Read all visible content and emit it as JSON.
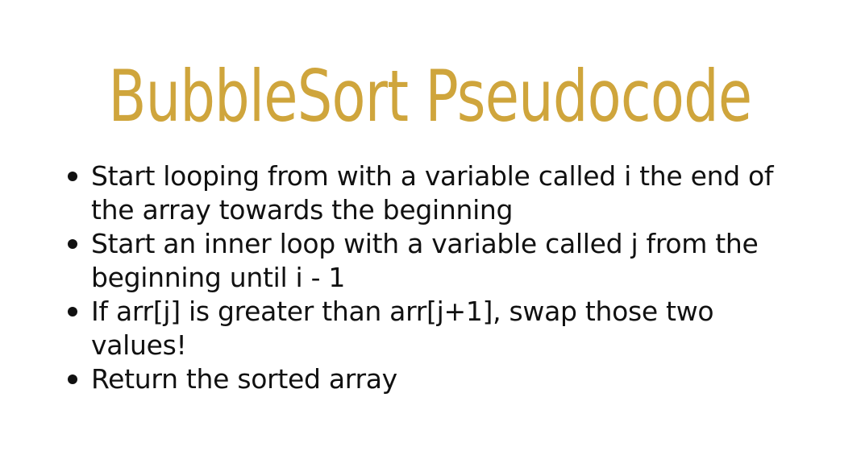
{
  "slide": {
    "title": "BubbleSort Pseudocode",
    "title_color": "#CFA53C",
    "bullets": [
      "Start looping from with a variable called i the end of the array towards the beginning",
      "Start an inner loop with a variable called j from the beginning until i - 1",
      "If arr[j] is greater than arr[j+1], swap those two values!",
      "Return the sorted array"
    ]
  }
}
